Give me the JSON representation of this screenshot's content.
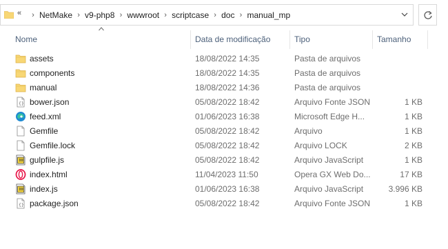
{
  "address": {
    "overflow_label": "«",
    "crumbs": [
      "NetMake",
      "v9-php8",
      "wwwroot",
      "scriptcase",
      "doc",
      "manual_mp"
    ],
    "separator": "›"
  },
  "columns": {
    "name": "Nome",
    "date": "Data de modificação",
    "type": "Tipo",
    "size": "Tamanho",
    "sort_indicator": "^"
  },
  "files": [
    {
      "icon": "folder-icon",
      "name": "assets",
      "date": "18/08/2022 14:35",
      "type": "Pasta de arquivos",
      "size": ""
    },
    {
      "icon": "folder-icon",
      "name": "components",
      "date": "18/08/2022 14:35",
      "type": "Pasta de arquivos",
      "size": ""
    },
    {
      "icon": "folder-icon",
      "name": "manual",
      "date": "18/08/2022 14:36",
      "type": "Pasta de arquivos",
      "size": ""
    },
    {
      "icon": "json-file-icon",
      "name": "bower.json",
      "date": "05/08/2022 18:42",
      "type": "Arquivo Fonte JSON",
      "size": "1 KB"
    },
    {
      "icon": "edge-xml-icon",
      "name": "feed.xml",
      "date": "01/06/2023 16:38",
      "type": "Microsoft Edge H...",
      "size": "1 KB"
    },
    {
      "icon": "blank-file-icon",
      "name": "Gemfile",
      "date": "05/08/2022 18:42",
      "type": "Arquivo",
      "size": "1 KB"
    },
    {
      "icon": "blank-file-icon",
      "name": "Gemfile.lock",
      "date": "05/08/2022 18:42",
      "type": "Arquivo LOCK",
      "size": "2 KB"
    },
    {
      "icon": "js-file-icon",
      "name": "gulpfile.js",
      "date": "05/08/2022 18:42",
      "type": "Arquivo JavaScript",
      "size": "1 KB"
    },
    {
      "icon": "opera-html-icon",
      "name": "index.html",
      "date": "11/04/2023 11:50",
      "type": "Opera GX Web Do...",
      "size": "17 KB"
    },
    {
      "icon": "js-file-icon",
      "name": "index.js",
      "date": "01/06/2023 16:38",
      "type": "Arquivo JavaScript",
      "size": "3.996 KB"
    },
    {
      "icon": "json-file-icon",
      "name": "package.json",
      "date": "05/08/2022 18:42",
      "type": "Arquivo Fonte JSON",
      "size": "1 KB"
    }
  ],
  "colors": {
    "folder": "#f8d775",
    "header_text": "#4c607a",
    "edge_blue": "#1f8ad2",
    "opera_red": "#e8174a"
  }
}
